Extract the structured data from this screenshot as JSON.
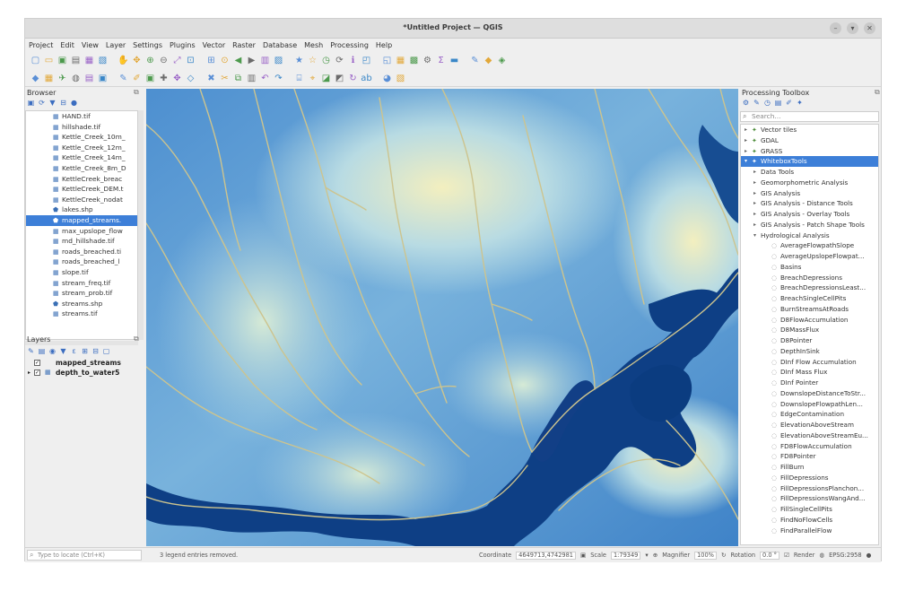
{
  "window": {
    "title": "*Untitled Project — QGIS",
    "buttons": [
      "–",
      "▾",
      "✕"
    ]
  },
  "menubar": [
    "Project",
    "Edit",
    "View",
    "Layer",
    "Settings",
    "Plugins",
    "Vector",
    "Raster",
    "Database",
    "Mesh",
    "Processing",
    "Help"
  ],
  "toolbar1_icons": [
    "new-project-icon",
    "open-project-icon",
    "save-project-icon",
    "save-as-icon",
    "print-layout-icon",
    "layout-manager-icon",
    "pan-icon",
    "pan-to-selection-icon",
    "zoom-in-icon",
    "zoom-out-icon",
    "zoom-full-icon",
    "zoom-selection-icon",
    "zoom-layer-icon",
    "zoom-native-icon",
    "zoom-last-icon",
    "zoom-next-icon",
    "new-map-view-icon",
    "new-3d-view-icon",
    "bookmark-icon",
    "show-bookmarks-icon",
    "temporal-controller-icon",
    "refresh-icon",
    "identify-icon",
    "select-icon",
    "deselect-icon",
    "attribute-table-icon",
    "field-calculator-icon",
    "processing-toolbox-icon",
    "statistics-icon",
    "measure-icon",
    "annotation-icon",
    "tips-icon",
    "map-tips-icon"
  ],
  "toolbar2_icons": [
    "add-vector-icon",
    "add-raster-icon",
    "add-spatialite-icon",
    "add-wms-icon",
    "add-csv-icon",
    "add-virtual-layer-icon",
    "digitize-icon",
    "toggle-editing-icon",
    "save-edits-icon",
    "add-feature-icon",
    "move-feature-icon",
    "vertex-tool-icon",
    "delete-selected-icon",
    "cut-features-icon",
    "copy-features-icon",
    "paste-features-icon",
    "undo-icon",
    "redo-icon",
    "label-tool-icon",
    "pin-labels-icon",
    "show-labels-icon",
    "highlight-labels-icon",
    "rotate-label-icon",
    "change-label-icon",
    "python-icon",
    "plugin-icon"
  ],
  "browser": {
    "title": "Browser",
    "items": [
      {
        "label": "HAND.tif",
        "icon": "raster-icon"
      },
      {
        "label": "hillshade.tif",
        "icon": "raster-icon"
      },
      {
        "label": "Kettle_Creek_10m_",
        "icon": "raster-icon"
      },
      {
        "label": "Kettle_Creek_12m_",
        "icon": "raster-icon"
      },
      {
        "label": "Kettle_Creek_14m_",
        "icon": "raster-icon"
      },
      {
        "label": "Kettle_Creek_8m_D",
        "icon": "raster-icon"
      },
      {
        "label": "KettleCreek_breac",
        "icon": "raster-icon"
      },
      {
        "label": "KettleCreek_DEM.t",
        "icon": "raster-icon"
      },
      {
        "label": "KettleCreek_nodat",
        "icon": "raster-icon"
      },
      {
        "label": "lakes.shp",
        "icon": "vector-icon"
      },
      {
        "label": "mapped_streams.",
        "icon": "vector-icon",
        "selected": true
      },
      {
        "label": "max_upslope_flow",
        "icon": "raster-icon"
      },
      {
        "label": "md_hillshade.tif",
        "icon": "raster-icon"
      },
      {
        "label": "roads_breached.ti",
        "icon": "raster-icon"
      },
      {
        "label": "roads_breached_l",
        "icon": "raster-icon"
      },
      {
        "label": "slope.tif",
        "icon": "raster-icon"
      },
      {
        "label": "stream_freq.tif",
        "icon": "raster-icon"
      },
      {
        "label": "stream_prob.tif",
        "icon": "raster-icon"
      },
      {
        "label": "streams.shp",
        "icon": "vector-icon"
      },
      {
        "label": "streams.tif",
        "icon": "raster-icon"
      }
    ]
  },
  "layers": {
    "title": "Layers",
    "items": [
      {
        "label": "mapped_streams",
        "checked": true
      },
      {
        "label": "depth_to_water5",
        "checked": true
      }
    ]
  },
  "toolbox": {
    "title": "Processing Toolbox",
    "search_placeholder": "Search...",
    "rows": [
      {
        "label": "Vector tiles",
        "level": 0,
        "expanded": false,
        "icon": "provider-icon"
      },
      {
        "label": "GDAL",
        "level": 0,
        "expanded": false,
        "icon": "provider-icon"
      },
      {
        "label": "GRASS",
        "level": 0,
        "expanded": false,
        "icon": "provider-icon"
      },
      {
        "label": "WhiteboxTools",
        "level": 0,
        "expanded": true,
        "icon": "provider-icon",
        "selected": true
      },
      {
        "label": "Data Tools",
        "level": 1,
        "expanded": false
      },
      {
        "label": "Geomorphometric Analysis",
        "level": 1,
        "expanded": false
      },
      {
        "label": "GIS Analysis",
        "level": 1,
        "expanded": false
      },
      {
        "label": "GIS Analysis - Distance Tools",
        "level": 1,
        "expanded": false
      },
      {
        "label": "GIS Analysis - Overlay Tools",
        "level": 1,
        "expanded": false
      },
      {
        "label": "GIS Analysis - Patch Shape Tools",
        "level": 1,
        "expanded": false
      },
      {
        "label": "Hydrological Analysis",
        "level": 1,
        "expanded": true
      },
      {
        "label": "AverageFlowpathSlope",
        "level": 2
      },
      {
        "label": "AverageUpslopeFlowpat...",
        "level": 2
      },
      {
        "label": "Basins",
        "level": 2
      },
      {
        "label": "BreachDepressions",
        "level": 2
      },
      {
        "label": "BreachDepressionsLeast...",
        "level": 2
      },
      {
        "label": "BreachSingleCellPits",
        "level": 2
      },
      {
        "label": "BurnStreamsAtRoads",
        "level": 2
      },
      {
        "label": "D8FlowAccumulation",
        "level": 2
      },
      {
        "label": "D8MassFlux",
        "level": 2
      },
      {
        "label": "D8Pointer",
        "level": 2
      },
      {
        "label": "DepthInSink",
        "level": 2
      },
      {
        "label": "DInf Flow Accumulation",
        "level": 2
      },
      {
        "label": "DInf Mass Flux",
        "level": 2
      },
      {
        "label": "DInf Pointer",
        "level": 2
      },
      {
        "label": "DownslopeDistanceToStr...",
        "level": 2
      },
      {
        "label": "DownslopeFlowpathLen...",
        "level": 2
      },
      {
        "label": "EdgeContamination",
        "level": 2
      },
      {
        "label": "ElevationAboveStream",
        "level": 2
      },
      {
        "label": "ElevationAboveStreamEu...",
        "level": 2
      },
      {
        "label": "FD8FlowAccumulation",
        "level": 2
      },
      {
        "label": "FD8Pointer",
        "level": 2
      },
      {
        "label": "FillBurn",
        "level": 2
      },
      {
        "label": "FillDepressions",
        "level": 2
      },
      {
        "label": "FillDepressionsPlanchon...",
        "level": 2
      },
      {
        "label": "FillDepressionsWangAnd...",
        "level": 2
      },
      {
        "label": "FillSingleCellPits",
        "level": 2
      },
      {
        "label": "FindNoFlowCells",
        "level": 2
      },
      {
        "label": "FindParallelFlow",
        "level": 2
      }
    ]
  },
  "statusbar": {
    "locator_placeholder": "Type to locate (Ctrl+K)",
    "message": "3 legend entries removed.",
    "coordinate_label": "Coordinate",
    "coordinate_value": "4649713,4742981",
    "scale_label": "Scale",
    "scale_value": "1:79349",
    "magnifier_label": "Magnifier",
    "magnifier_value": "100%",
    "rotation_label": "Rotation",
    "rotation_value": "0.0 °",
    "render_label": "Render",
    "crs_label": "EPSG:2958"
  },
  "colors": {
    "selection": "#3d7fd8",
    "water_deep": "#0d3f86",
    "water_mid": "#3f86c8",
    "terrain_low": "#a9d3e8",
    "terrain_high": "#f2efc2",
    "stream_line": "#c8c08a"
  }
}
